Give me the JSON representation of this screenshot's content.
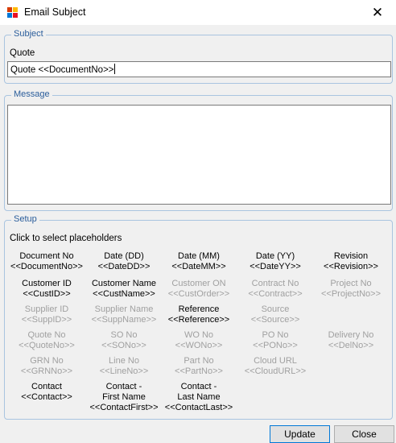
{
  "window": {
    "title": "Email Subject",
    "close_glyph": "✕",
    "icon": "app-grid-icon",
    "icon_colors": [
      "#d83b01",
      "#ffb900",
      "#0078d7",
      "#e81123"
    ]
  },
  "subject": {
    "legend": "Subject",
    "label": "Quote",
    "value": "Quote <<DocumentNo>>"
  },
  "message": {
    "legend": "Message",
    "value": ""
  },
  "setup": {
    "legend": "Setup",
    "instruction": "Click to select placeholders",
    "placeholders": [
      {
        "name": "Document No",
        "token": "<<DocumentNo>>",
        "enabled": true
      },
      {
        "name": "Date (DD)",
        "token": "<<DateDD>>",
        "enabled": true
      },
      {
        "name": "Date (MM)",
        "token": "<<DateMM>>",
        "enabled": true
      },
      {
        "name": "Date (YY)",
        "token": "<<DateYY>>",
        "enabled": true
      },
      {
        "name": "Revision",
        "token": "<<Revision>>",
        "enabled": true
      },
      {
        "name": "Customer ID",
        "token": "<<CustID>>",
        "enabled": true
      },
      {
        "name": "Customer Name",
        "token": "<<CustName>>",
        "enabled": true
      },
      {
        "name": "Customer ON",
        "token": "<<CustOrder>>",
        "enabled": false
      },
      {
        "name": "Contract No",
        "token": "<<Contract>>",
        "enabled": false
      },
      {
        "name": "Project No",
        "token": "<<ProjectNo>>",
        "enabled": false
      },
      {
        "name": "Supplier ID",
        "token": "<<SuppID>>",
        "enabled": false
      },
      {
        "name": "Supplier Name",
        "token": "<<SuppName>>",
        "enabled": false
      },
      {
        "name": "Reference",
        "token": "<<Reference>>",
        "enabled": true
      },
      {
        "name": "Source",
        "token": "<<Source>>",
        "enabled": false
      },
      {
        "name": "",
        "token": "",
        "enabled": false
      },
      {
        "name": "Quote No",
        "token": "<<QuoteNo>>",
        "enabled": false
      },
      {
        "name": "SO No",
        "token": "<<SONo>>",
        "enabled": false
      },
      {
        "name": "WO No",
        "token": "<<WONo>>",
        "enabled": false
      },
      {
        "name": "PO No",
        "token": "<<PONo>>",
        "enabled": false
      },
      {
        "name": "Delivery No",
        "token": "<<DelNo>>",
        "enabled": false
      },
      {
        "name": "GRN No",
        "token": "<<GRNNo>>",
        "enabled": false
      },
      {
        "name": "Line No",
        "token": "<<LineNo>>",
        "enabled": false
      },
      {
        "name": "Part No",
        "token": "<<PartNo>>",
        "enabled": false
      },
      {
        "name": "Cloud URL",
        "token": "<<CloudURL>>",
        "enabled": false
      },
      {
        "name": "",
        "token": "",
        "enabled": false
      },
      {
        "name": "Contact",
        "token": "<<Contact>>",
        "enabled": true
      },
      {
        "name": "Contact -\nFirst Name",
        "token": "<<ContactFirst>>",
        "enabled": true
      },
      {
        "name": "Contact -\nLast Name",
        "token": "<<ContactLast>>",
        "enabled": true
      }
    ]
  },
  "buttons": {
    "update": "Update",
    "close": "Close"
  },
  "colors": {
    "group_border": "#a9c4e0",
    "legend_text": "#2a5d9b",
    "disabled_text": "#a0a0a0",
    "default_button_border": "#0078d7"
  }
}
